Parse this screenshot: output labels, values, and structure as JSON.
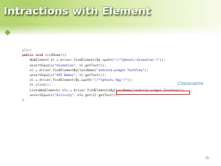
{
  "slide": {
    "title": "Intractions with Element",
    "callout_label": "Classname",
    "page_number": "29"
  },
  "code_lines": [
    [
      {
        "t": "@Test",
        "c": "ann"
      }
    ],
    [
      {
        "t": "public void ",
        "c": "kw"
      },
      {
        "t": "src2Demo(){",
        "c": ""
      }
    ],
    [
      {
        "t": "    WebElement el = driver.findElement(By.xpath(",
        "c": ""
      },
      {
        "t": "\"//*[@text='Animation']\"",
        "c": "str"
      },
      {
        "t": "));",
        "c": ""
      }
    ],
    [
      {
        "t": "    assertEquals(",
        "c": ""
      },
      {
        "t": "\"Animation\"",
        "c": "str"
      },
      {
        "t": ", el.getText());",
        "c": ""
      }
    ],
    [
      {
        "t": "    el = driver.findElementByClassName(",
        "c": ""
      },
      {
        "t": "\"android.widget.TextView\"",
        "c": "str"
      },
      {
        "t": ");",
        "c": ""
      }
    ],
    [
      {
        "t": "    assertEquals(",
        "c": ""
      },
      {
        "t": "\"API Demos\"",
        "c": "str"
      },
      {
        "t": ", el.getText());",
        "c": ""
      }
    ],
    [
      {
        "t": "    el = driver.findElement(By.xpath(",
        "c": ""
      },
      {
        "t": "\"//*[@text='App']\"",
        "c": "str"
      },
      {
        "t": "));",
        "c": ""
      }
    ],
    [
      {
        "t": "    el.click();",
        "c": ""
      }
    ],
    [
      {
        "t": "    List<WebElement> els = driver.findElementsByClassName(",
        "c": ""
      },
      {
        "t": "\"android.widget.TextView\"",
        "c": "str"
      },
      {
        "t": ");",
        "c": ""
      }
    ],
    [
      {
        "t": "    assertEquals(",
        "c": ""
      },
      {
        "t": "\"Activity\"",
        "c": "str"
      },
      {
        "t": ", els.get(2).getText());",
        "c": ""
      }
    ],
    [
      {
        "t": "}",
        "c": ""
      }
    ]
  ]
}
